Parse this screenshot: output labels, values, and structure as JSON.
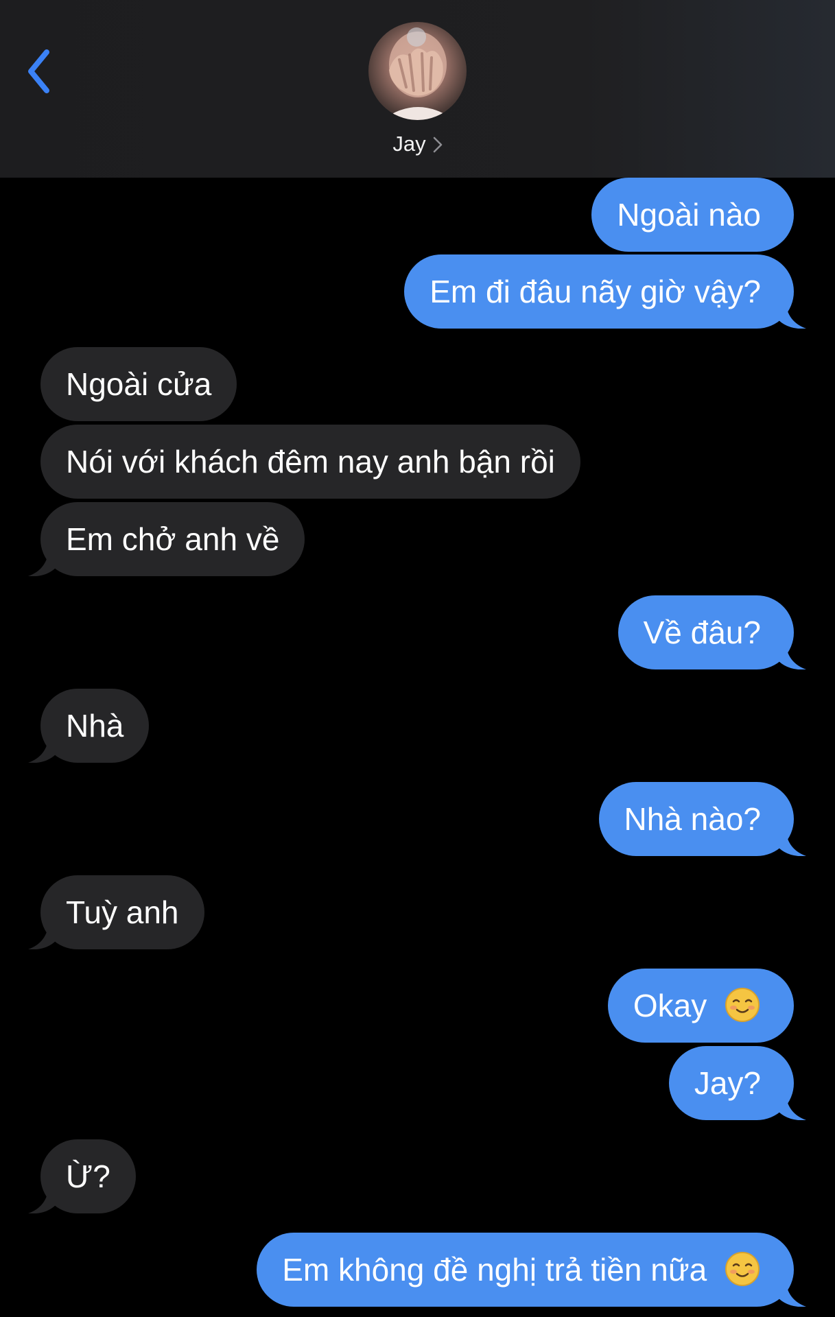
{
  "header": {
    "contact_name": "Jay"
  },
  "messages": [
    {
      "side": "sent",
      "text": "Ngoài nào",
      "emoji": ""
    },
    {
      "side": "sent",
      "text": "Em đi đâu nãy giờ vậy?",
      "emoji": ""
    },
    {
      "side": "recv",
      "text": "Ngoài cửa",
      "emoji": ""
    },
    {
      "side": "recv",
      "text": "Nói với khách đêm nay anh bận rồi",
      "emoji": ""
    },
    {
      "side": "recv",
      "text": "Em chở anh về",
      "emoji": ""
    },
    {
      "side": "sent",
      "text": "Về đâu?",
      "emoji": ""
    },
    {
      "side": "recv",
      "text": "Nhà",
      "emoji": ""
    },
    {
      "side": "sent",
      "text": "Nhà nào?",
      "emoji": ""
    },
    {
      "side": "recv",
      "text": "Tuỳ anh",
      "emoji": ""
    },
    {
      "side": "sent",
      "text": "Okay",
      "emoji": "smiling-face-icon"
    },
    {
      "side": "sent",
      "text": "Jay?",
      "emoji": ""
    },
    {
      "side": "recv",
      "text": "Ừ?",
      "emoji": ""
    },
    {
      "side": "sent",
      "text": "Em không đề nghị trả tiền nữa",
      "emoji": "smiling-face-icon"
    }
  ],
  "colors": {
    "sent_bubble": "#4a8ff0",
    "received_bubble": "#262628",
    "accent": "#3b82f6",
    "background": "#000000"
  }
}
